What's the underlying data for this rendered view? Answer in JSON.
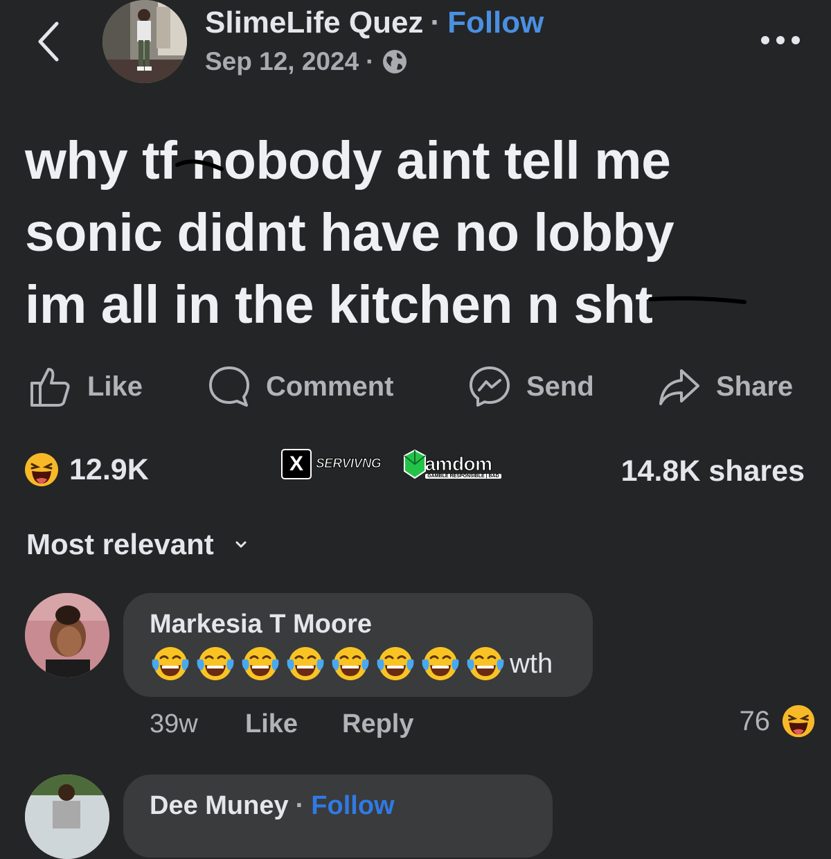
{
  "post": {
    "author": "SlimeLife Quez",
    "separator": "·",
    "follow_label": "Follow",
    "date": "Sep 12, 2024",
    "audience_icon": "globe-icon",
    "text_lines": [
      "why tf nobody aint tell me",
      "sonic didnt have no lobby",
      "im all in the kitchen n sht"
    ]
  },
  "actions": {
    "like": "Like",
    "comment": "Comment",
    "send": "Send",
    "share": "Share"
  },
  "stats": {
    "reaction_icon": "haha-emoji-icon",
    "reactions": "12.9K",
    "shares": "14.8K shares"
  },
  "watermark": {
    "x_logo": "X",
    "handle": "SERVIVNG",
    "brand": "Gamdom",
    "tagline": "GAMBLE RESPONSIBLE | BAD"
  },
  "sort": {
    "label": "Most relevant"
  },
  "comments": [
    {
      "author": "Markesia T Moore",
      "emoji_icon": "tears-of-joy-emoji-icon",
      "emoji_count": 8,
      "text": "wth",
      "time": "39w",
      "like_label": "Like",
      "reply_label": "Reply",
      "reaction_count": "76",
      "reaction_icon": "haha-emoji-icon"
    },
    {
      "author": "Dee Muney",
      "separator": "·",
      "follow_label": "Follow"
    }
  ],
  "colors": {
    "background": "#242526",
    "bubble": "#3a3b3c",
    "follow_blue": "#4a90e2",
    "muted_text": "#b0b3b8",
    "primary_text": "#e4e6eb"
  }
}
